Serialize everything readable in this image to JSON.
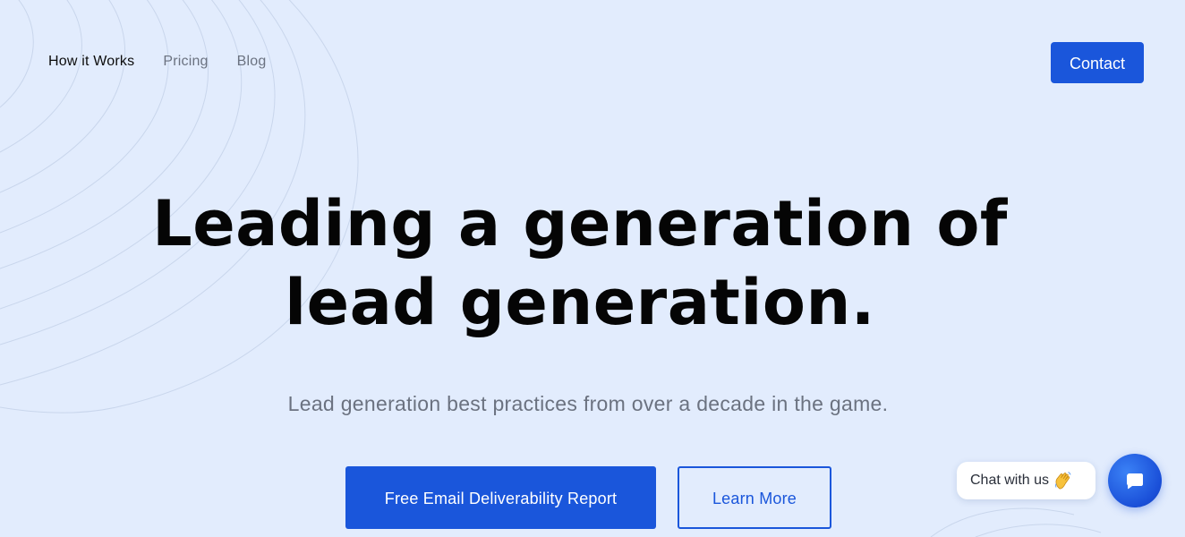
{
  "nav": {
    "items": [
      {
        "label": "How it Works",
        "active": true
      },
      {
        "label": "Pricing",
        "active": false
      },
      {
        "label": "Blog",
        "active": false
      }
    ],
    "contact_label": "Contact"
  },
  "hero": {
    "title_line1": "Leading a generation of",
    "title_line2": "lead generation.",
    "subtitle": "Lead generation best practices from over a decade in the game.",
    "primary_cta": "Free Email Deliverability Report",
    "secondary_cta": "Learn More"
  },
  "chat": {
    "bubble_text": "Chat with us",
    "bubble_icon": "waving-hand-icon",
    "launcher_icon": "chat-icon"
  },
  "colors": {
    "background": "#e2ecfd",
    "accent": "#1a56db",
    "heading": "#050505",
    "muted": "#6b7280"
  }
}
